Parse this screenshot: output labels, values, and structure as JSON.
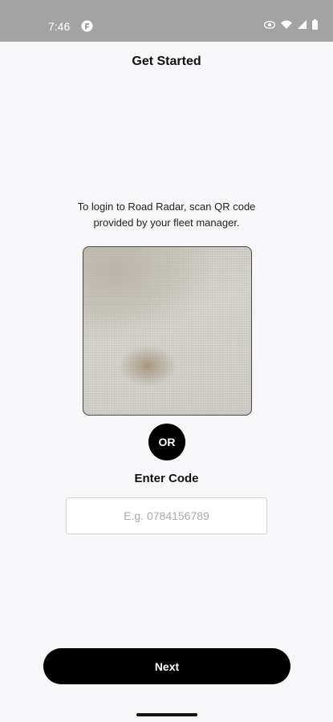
{
  "status_bar": {
    "time": "7:46",
    "app_icon": "fleet-app-icon",
    "icons": [
      "eye-icon",
      "wifi-icon",
      "signal-icon",
      "battery-icon"
    ]
  },
  "screen": {
    "title": "Get Started",
    "instructions": "To login to Road Radar, scan QR code provided by your fleet manager.",
    "camera_preview": "qr-scanner-camera-preview",
    "or_label": "OR",
    "enter_code_label": "Enter Code",
    "code_input": {
      "value": "",
      "placeholder": "E.g. 0784156789"
    },
    "next_label": "Next"
  },
  "colors": {
    "background": "#f7f7f9",
    "status_bar": "#a3a3a3",
    "primary": "#000000",
    "primary_text": "#ffffff"
  }
}
